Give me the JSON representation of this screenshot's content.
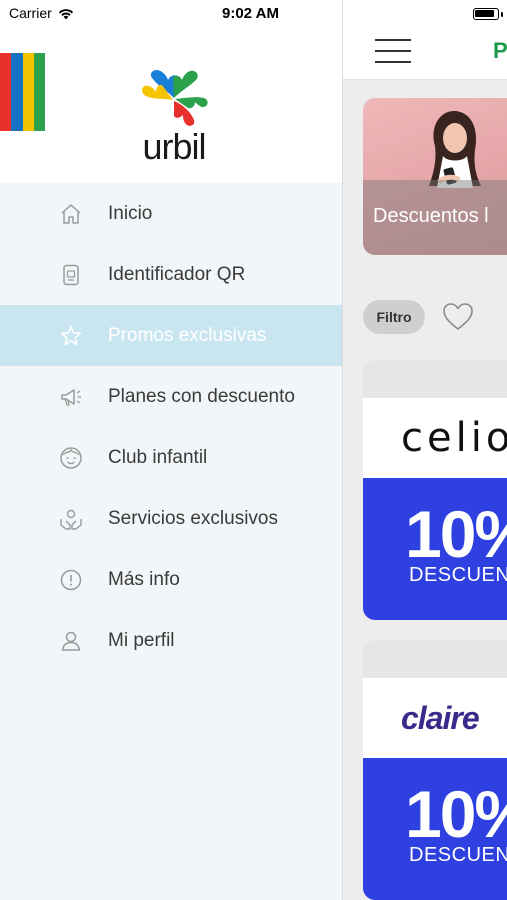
{
  "status_bar": {
    "carrier": "Carrier",
    "time": "9:02 AM"
  },
  "drawer": {
    "logo_text": "urbil",
    "stripe_colors": [
      "#e8312d",
      "#1673c4",
      "#f5c400",
      "#2aa14a"
    ],
    "active_color": "#c9e6f0",
    "items": [
      {
        "label": "Inicio",
        "icon": "home-icon"
      },
      {
        "label": "Identificador QR",
        "icon": "qr-id-icon"
      },
      {
        "label": "Promos exclusivas",
        "icon": "star-icon",
        "active": true
      },
      {
        "label": "Planes con descuento",
        "icon": "megaphone-icon"
      },
      {
        "label": "Club infantil",
        "icon": "child-face-icon"
      },
      {
        "label": "Servicios exclusivos",
        "icon": "hands-service-icon"
      },
      {
        "label": "Más info",
        "icon": "info-icon"
      },
      {
        "label": "Mi perfil",
        "icon": "user-icon"
      }
    ]
  },
  "main": {
    "header_title": "P",
    "banner_text": "Descuentos l",
    "filter_label": "Filtro",
    "cards": [
      {
        "brand": "celio",
        "offer": "10%",
        "offer_sub": "DESCUEN"
      },
      {
        "brand": "claire",
        "offer": "10%",
        "offer_sub": "DESCUEN"
      }
    ],
    "offer_color": "#2f40e0",
    "accent_color": "#1a9a4a"
  }
}
